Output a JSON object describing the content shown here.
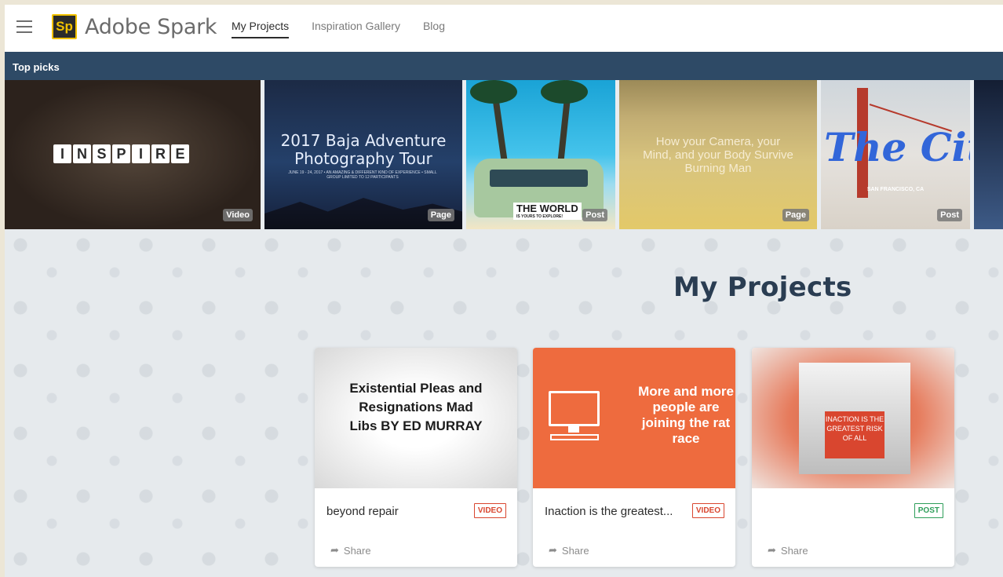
{
  "header": {
    "logo": "Sp",
    "brand": "Adobe Spark",
    "nav": [
      {
        "label": "My Projects"
      },
      {
        "label": "Inspiration Gallery"
      },
      {
        "label": "Blog"
      }
    ]
  },
  "top_picks": {
    "title": "Top picks",
    "items": [
      {
        "text": "INSPIRE",
        "badge": "Video"
      },
      {
        "title": "2017 Baja Adventure Photography Tour",
        "sub": "JUNE 19 - 24, 2017 • AN AMAZING & DIFFERENT KIND OF EXPERIENCE • SMALL GROUP LIMITED TO 12 PARTICIPANTS",
        "badge": "Page"
      },
      {
        "title": "THE WORLD",
        "sub": "IS YOURS TO EXPLORE!",
        "badge": "Post"
      },
      {
        "title": "How your Camera, your Mind, and your Body Survive Burning Man",
        "badge": "Page"
      },
      {
        "title": "The City",
        "sub": "SAN FRANCISCO, CA",
        "badge": "Post"
      }
    ]
  },
  "main": {
    "title": "My Projects",
    "projects": [
      {
        "thumb_text": "Existential Pleas and Resignations Mad Libs BY ED MURRAY",
        "name": "beyond repair",
        "type": "VIDEO",
        "share": "Share"
      },
      {
        "thumb_text": "More and more people are joining the rat race",
        "name": "Inaction is the greatest...",
        "type": "VIDEO",
        "share": "Share"
      },
      {
        "thumb_text": "INACTION IS THE GREATEST RISK OF ALL",
        "name": "",
        "type": "POST",
        "share": "Share"
      }
    ]
  }
}
